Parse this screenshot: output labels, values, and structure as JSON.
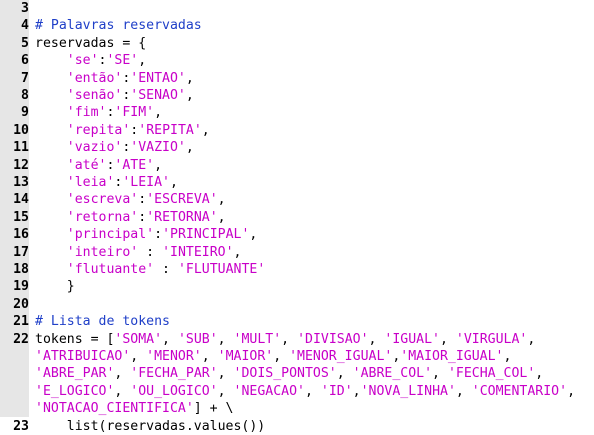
{
  "colors": {
    "comment": "#1f3fc8",
    "string": "#c800c8",
    "text": "#000000",
    "gutter": "#e6e6e6"
  },
  "lines": [
    {
      "n": "3",
      "segs": []
    },
    {
      "n": "4",
      "segs": [
        {
          "t": "c",
          "v": "# Palavras reservadas"
        }
      ]
    },
    {
      "n": "5",
      "segs": [
        {
          "t": "p",
          "v": "reservadas = {"
        }
      ]
    },
    {
      "n": "6",
      "segs": [
        {
          "t": "p",
          "v": "    "
        },
        {
          "t": "s",
          "v": "'se'"
        },
        {
          "t": "p",
          "v": ":"
        },
        {
          "t": "s",
          "v": "'SE'"
        },
        {
          "t": "p",
          "v": ","
        }
      ]
    },
    {
      "n": "7",
      "segs": [
        {
          "t": "p",
          "v": "    "
        },
        {
          "t": "s",
          "v": "'então'"
        },
        {
          "t": "p",
          "v": ":"
        },
        {
          "t": "s",
          "v": "'ENTAO'"
        },
        {
          "t": "p",
          "v": ","
        }
      ]
    },
    {
      "n": "8",
      "segs": [
        {
          "t": "p",
          "v": "    "
        },
        {
          "t": "s",
          "v": "'senão'"
        },
        {
          "t": "p",
          "v": ":"
        },
        {
          "t": "s",
          "v": "'SENAO'"
        },
        {
          "t": "p",
          "v": ","
        }
      ]
    },
    {
      "n": "9",
      "segs": [
        {
          "t": "p",
          "v": "    "
        },
        {
          "t": "s",
          "v": "'fim'"
        },
        {
          "t": "p",
          "v": ":"
        },
        {
          "t": "s",
          "v": "'FIM'"
        },
        {
          "t": "p",
          "v": ","
        }
      ]
    },
    {
      "n": "10",
      "segs": [
        {
          "t": "p",
          "v": "    "
        },
        {
          "t": "s",
          "v": "'repita'"
        },
        {
          "t": "p",
          "v": ":"
        },
        {
          "t": "s",
          "v": "'REPITA'"
        },
        {
          "t": "p",
          "v": ","
        }
      ]
    },
    {
      "n": "11",
      "segs": [
        {
          "t": "p",
          "v": "    "
        },
        {
          "t": "s",
          "v": "'vazio'"
        },
        {
          "t": "p",
          "v": ":"
        },
        {
          "t": "s",
          "v": "'VAZIO'"
        },
        {
          "t": "p",
          "v": ","
        }
      ]
    },
    {
      "n": "12",
      "segs": [
        {
          "t": "p",
          "v": "    "
        },
        {
          "t": "s",
          "v": "'até'"
        },
        {
          "t": "p",
          "v": ":"
        },
        {
          "t": "s",
          "v": "'ATE'"
        },
        {
          "t": "p",
          "v": ","
        }
      ]
    },
    {
      "n": "13",
      "segs": [
        {
          "t": "p",
          "v": "    "
        },
        {
          "t": "s",
          "v": "'leia'"
        },
        {
          "t": "p",
          "v": ":"
        },
        {
          "t": "s",
          "v": "'LEIA'"
        },
        {
          "t": "p",
          "v": ","
        }
      ]
    },
    {
      "n": "14",
      "segs": [
        {
          "t": "p",
          "v": "    "
        },
        {
          "t": "s",
          "v": "'escreva'"
        },
        {
          "t": "p",
          "v": ":"
        },
        {
          "t": "s",
          "v": "'ESCREVA'"
        },
        {
          "t": "p",
          "v": ","
        }
      ]
    },
    {
      "n": "15",
      "segs": [
        {
          "t": "p",
          "v": "    "
        },
        {
          "t": "s",
          "v": "'retorna'"
        },
        {
          "t": "p",
          "v": ":"
        },
        {
          "t": "s",
          "v": "'RETORNA'"
        },
        {
          "t": "p",
          "v": ","
        }
      ]
    },
    {
      "n": "16",
      "segs": [
        {
          "t": "p",
          "v": "    "
        },
        {
          "t": "s",
          "v": "'principal'"
        },
        {
          "t": "p",
          "v": ":"
        },
        {
          "t": "s",
          "v": "'PRINCIPAL'"
        },
        {
          "t": "p",
          "v": ","
        }
      ]
    },
    {
      "n": "17",
      "segs": [
        {
          "t": "p",
          "v": "    "
        },
        {
          "t": "s",
          "v": "'inteiro'"
        },
        {
          "t": "p",
          "v": " : "
        },
        {
          "t": "s",
          "v": "'INTEIRO'"
        },
        {
          "t": "p",
          "v": ","
        }
      ]
    },
    {
      "n": "18",
      "segs": [
        {
          "t": "p",
          "v": "    "
        },
        {
          "t": "s",
          "v": "'flutuante'"
        },
        {
          "t": "p",
          "v": " : "
        },
        {
          "t": "s",
          "v": "'FLUTUANTE'"
        }
      ]
    },
    {
      "n": "19",
      "segs": [
        {
          "t": "p",
          "v": "    }"
        }
      ]
    },
    {
      "n": "20",
      "segs": []
    },
    {
      "n": "21",
      "segs": [
        {
          "t": "c",
          "v": "# Lista de tokens"
        }
      ]
    },
    {
      "n": "22",
      "segs": [
        {
          "t": "p",
          "v": "tokens = ["
        },
        {
          "t": "s",
          "v": "'SOMA'"
        },
        {
          "t": "p",
          "v": ", "
        },
        {
          "t": "s",
          "v": "'SUB'"
        },
        {
          "t": "p",
          "v": ", "
        },
        {
          "t": "s",
          "v": "'MULT'"
        },
        {
          "t": "p",
          "v": ", "
        },
        {
          "t": "s",
          "v": "'DIVISAO'"
        },
        {
          "t": "p",
          "v": ", "
        },
        {
          "t": "s",
          "v": "'IGUAL'"
        },
        {
          "t": "p",
          "v": ", "
        },
        {
          "t": "s",
          "v": "'VIRGULA'"
        },
        {
          "t": "p",
          "v": ","
        }
      ]
    },
    {
      "n": "",
      "segs": [
        {
          "t": "s",
          "v": "'ATRIBUICAO'"
        },
        {
          "t": "p",
          "v": ", "
        },
        {
          "t": "s",
          "v": "'MENOR'"
        },
        {
          "t": "p",
          "v": ", "
        },
        {
          "t": "s",
          "v": "'MAIOR'"
        },
        {
          "t": "p",
          "v": ", "
        },
        {
          "t": "s",
          "v": "'MENOR_IGUAL'"
        },
        {
          "t": "p",
          "v": ","
        },
        {
          "t": "s",
          "v": "'MAIOR_IGUAL'"
        },
        {
          "t": "p",
          "v": ","
        }
      ]
    },
    {
      "n": "",
      "segs": [
        {
          "t": "s",
          "v": "'ABRE_PAR'"
        },
        {
          "t": "p",
          "v": ", "
        },
        {
          "t": "s",
          "v": "'FECHA_PAR'"
        },
        {
          "t": "p",
          "v": ", "
        },
        {
          "t": "s",
          "v": "'DOIS_PONTOS'"
        },
        {
          "t": "p",
          "v": ", "
        },
        {
          "t": "s",
          "v": "'ABRE_COL'"
        },
        {
          "t": "p",
          "v": ", "
        },
        {
          "t": "s",
          "v": "'FECHA_COL'"
        },
        {
          "t": "p",
          "v": ","
        }
      ]
    },
    {
      "n": "",
      "segs": [
        {
          "t": "s",
          "v": "'E_LOGICO'"
        },
        {
          "t": "p",
          "v": ", "
        },
        {
          "t": "s",
          "v": "'OU_LOGICO'"
        },
        {
          "t": "p",
          "v": ", "
        },
        {
          "t": "s",
          "v": "'NEGACAO'"
        },
        {
          "t": "p",
          "v": ", "
        },
        {
          "t": "s",
          "v": "'ID'"
        },
        {
          "t": "p",
          "v": ","
        },
        {
          "t": "s",
          "v": "'NOVA_LINHA'"
        },
        {
          "t": "p",
          "v": ", "
        },
        {
          "t": "s",
          "v": "'COMENTARIO'"
        },
        {
          "t": "p",
          "v": ","
        }
      ]
    },
    {
      "n": "",
      "segs": [
        {
          "t": "s",
          "v": "'NOTACAO_CIENTIFICA'"
        },
        {
          "t": "p",
          "v": "] + \\"
        }
      ]
    },
    {
      "n": "23",
      "segs": [
        {
          "t": "p",
          "v": "    list(reservadas.values())"
        }
      ]
    }
  ]
}
